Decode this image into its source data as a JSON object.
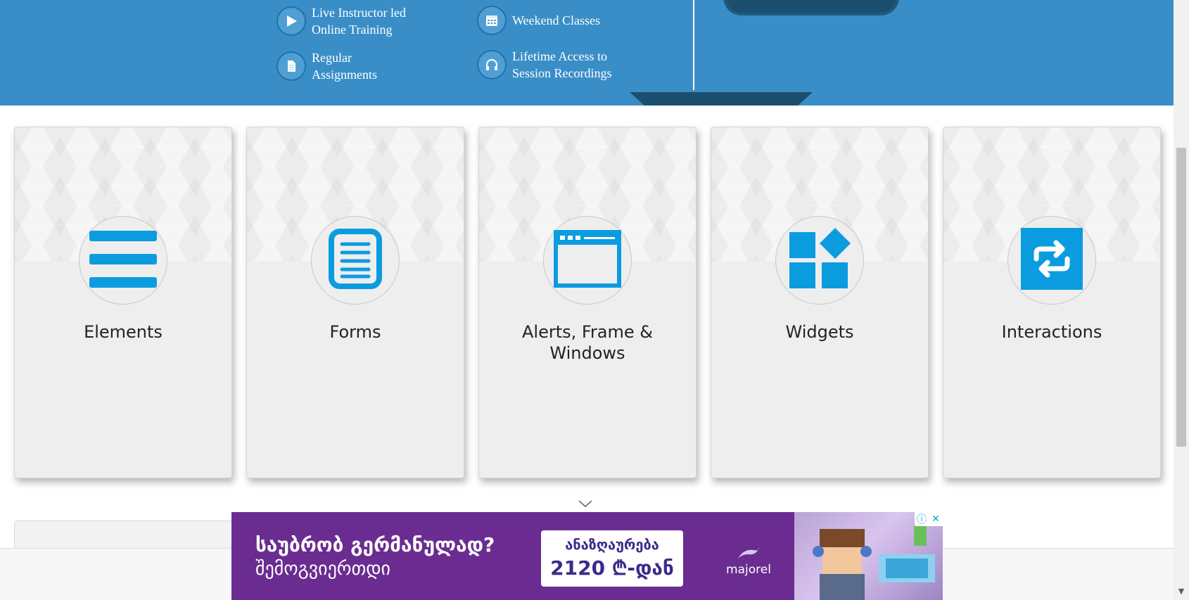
{
  "banner": {
    "features": [
      {
        "label": "Live Instructor led\nOnline Training",
        "icon": "play-icon"
      },
      {
        "label": "Weekend Classes",
        "icon": "calendar-icon"
      },
      {
        "label": "Regular\nAssignments",
        "icon": "document-icon"
      },
      {
        "label": "Lifetime Access to\nSession Recordings",
        "icon": "headphones-icon"
      }
    ]
  },
  "cards": [
    {
      "title": "Elements",
      "icon": "hamburger-icon"
    },
    {
      "title": "Forms",
      "icon": "form-document-icon"
    },
    {
      "title": "Alerts, Frame & Windows",
      "icon": "browser-window-icon"
    },
    {
      "title": "Widgets",
      "icon": "widgets-icon"
    },
    {
      "title": "Interactions",
      "icon": "repeat-arrows-icon"
    }
  ],
  "ad": {
    "headline": "საუბრობ გერმანულად?",
    "subline": "შემოგვიერთდი",
    "price_label": "ანაზღაურება",
    "price_value": "2120 ₾-დან",
    "brand": "majorel",
    "info_symbol": "ⓘ",
    "close_symbol": "✕"
  },
  "colors": {
    "banner": "#3a8ec7",
    "banner_dark": "#1c4e6e",
    "icon_blue": "#0b9ce0",
    "card_bg": "#eeeeee",
    "ad_bg": "#6a2c91"
  }
}
